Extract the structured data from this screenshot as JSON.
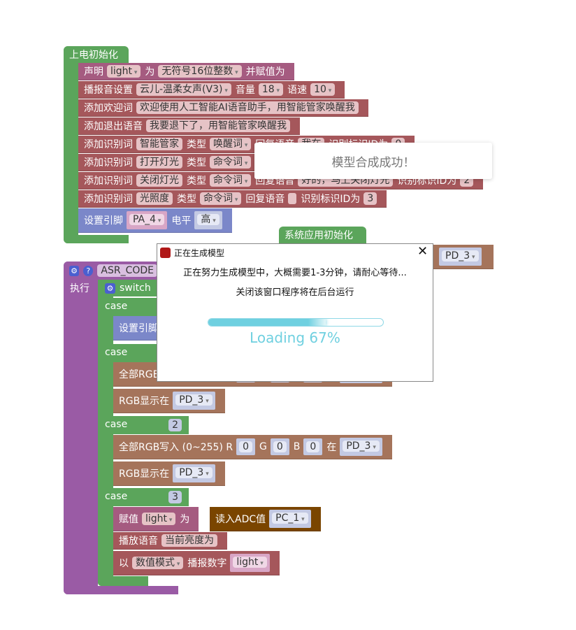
{
  "colors": {
    "block_red": "#a5575b",
    "block_purple": "#a55b80",
    "block_green": "#5ba55b",
    "block_blue": "#7b87c9",
    "block_brown": "#a5745b",
    "block_dark_brown": "#7a4500",
    "block_violet": "#9a5ba5",
    "progress": "#6fd0e0"
  },
  "setup": {
    "title": "上电初始化",
    "rows": [
      [
        {
          "t": "l",
          "v": "声明"
        },
        {
          "t": "d",
          "v": "light"
        },
        {
          "t": "l",
          "v": "为"
        },
        {
          "t": "d",
          "v": "无符号16位整数"
        },
        {
          "t": "l",
          "v": "并赋值为"
        }
      ],
      [
        {
          "t": "l",
          "v": "播报音设置"
        },
        {
          "t": "d",
          "v": "云儿-温柔女声(V3)"
        },
        {
          "t": "l",
          "v": "音量"
        },
        {
          "t": "d",
          "v": "18"
        },
        {
          "t": "l",
          "v": "语速"
        },
        {
          "t": "d",
          "v": "10"
        }
      ],
      [
        {
          "t": "l",
          "v": "添加欢迎词"
        },
        {
          "t": "f",
          "v": "欢迎使用人工智能AI语音助手，用智能管家唤醒我"
        }
      ],
      [
        {
          "t": "l",
          "v": "添加退出语音"
        },
        {
          "t": "f",
          "v": "我要退下了，用智能管家唤醒我"
        }
      ],
      [
        {
          "t": "l",
          "v": "添加识别词"
        },
        {
          "t": "f",
          "v": "智能管家"
        },
        {
          "t": "l",
          "v": "类型"
        },
        {
          "t": "d",
          "v": "唤醒词"
        },
        {
          "t": "l",
          "v": "回复语音"
        },
        {
          "t": "f",
          "v": "我在"
        },
        {
          "t": "l",
          "v": "识别标识ID为"
        },
        {
          "t": "f",
          "v": "0"
        }
      ],
      [
        {
          "t": "l",
          "v": "添加识别词"
        },
        {
          "t": "f",
          "v": "打开灯光"
        },
        {
          "t": "l",
          "v": "类型"
        },
        {
          "t": "d",
          "v": "命令词"
        },
        {
          "t": "l",
          "v": "回复语音"
        },
        {
          "t": "f",
          "v": "好的，马上打开灯光"
        },
        {
          "t": "l",
          "v": "识别标识ID为"
        },
        {
          "t": "f",
          "v": "1"
        }
      ],
      [
        {
          "t": "l",
          "v": "添加识别词"
        },
        {
          "t": "f",
          "v": "关闭灯光"
        },
        {
          "t": "l",
          "v": "类型"
        },
        {
          "t": "d",
          "v": "命令词"
        },
        {
          "t": "l",
          "v": "回复语音"
        },
        {
          "t": "f",
          "v": "好的，马上关闭灯光"
        },
        {
          "t": "l",
          "v": "识别标识ID为"
        },
        {
          "t": "f",
          "v": "2"
        }
      ],
      [
        {
          "t": "l",
          "v": "添加识别词"
        },
        {
          "t": "f",
          "v": "光照度"
        },
        {
          "t": "l",
          "v": "类型"
        },
        {
          "t": "d",
          "v": "命令词"
        },
        {
          "t": "l",
          "v": "回复语音"
        },
        {
          "t": "e"
        },
        {
          "t": "l",
          "v": "识别标识ID为"
        },
        {
          "t": "f",
          "v": "3"
        }
      ],
      [
        {
          "t": "l",
          "v": "设置引脚"
        },
        {
          "t": "sd",
          "v": "PA_4",
          "pink": true
        },
        {
          "t": "l",
          "v": "电平"
        },
        {
          "t": "sd",
          "v": "高"
        }
      ]
    ]
  },
  "app_init": {
    "title": "系统应用初始化",
    "pin": "PD_3"
  },
  "asr": {
    "field": "ASR_CODE",
    "exec": "执行",
    "switch": "switch",
    "case": "case",
    "rows": [
      [
        {
          "t": "l",
          "v": "设置引脚"
        }
      ],
      [
        {
          "t": "l",
          "v": "全部RGB写入 (0~255) R"
        },
        {
          "t": "s",
          "v": "0"
        },
        {
          "t": "l",
          "v": "G"
        },
        {
          "t": "s",
          "v": "0"
        },
        {
          "t": "l",
          "v": "B"
        },
        {
          "t": "s",
          "v": "0"
        },
        {
          "t": "l",
          "v": "在"
        },
        {
          "t": "sd",
          "v": "PD_3"
        }
      ],
      [
        {
          "t": "l",
          "v": "RGB显示在"
        },
        {
          "t": "sd",
          "v": "PD_3"
        }
      ],
      [
        {
          "t": "l",
          "v": "全部RGB写入 (0~255) R"
        },
        {
          "t": "s",
          "v": "0"
        },
        {
          "t": "l",
          "v": "G"
        },
        {
          "t": "s",
          "v": "0"
        },
        {
          "t": "l",
          "v": "B"
        },
        {
          "t": "s",
          "v": "0"
        },
        {
          "t": "l",
          "v": "在"
        },
        {
          "t": "sd",
          "v": "PD_3"
        }
      ],
      [
        {
          "t": "l",
          "v": "RGB显示在"
        },
        {
          "t": "sd",
          "v": "PD_3"
        }
      ],
      [
        {
          "t": "l",
          "v": "赋值"
        },
        {
          "t": "d",
          "v": "light"
        },
        {
          "t": "l",
          "v": "为"
        }
      ],
      [
        {
          "t": "l",
          "v": "读入ADC值"
        },
        {
          "t": "sd",
          "v": "PC_1"
        }
      ],
      [
        {
          "t": "l",
          "v": "播放语音"
        },
        {
          "t": "f",
          "v": "当前亮度为"
        }
      ],
      [
        {
          "t": "l",
          "v": "以"
        },
        {
          "t": "d",
          "v": "数值模式"
        },
        {
          "t": "l",
          "v": "播报数字"
        },
        {
          "t": "sd",
          "v": "light",
          "pink": true
        }
      ]
    ],
    "case_values": [
      "2",
      "3"
    ]
  },
  "toast": {
    "message": "模型合成成功！"
  },
  "dialog": {
    "title": "正在生成模型",
    "line1": "正在努力生成模型中，大概需要1-3分钟，请耐心等待...",
    "line2": "关闭该窗口程序将在后台运行",
    "progress_percent": 67,
    "loading_text": "Loading 67%"
  }
}
